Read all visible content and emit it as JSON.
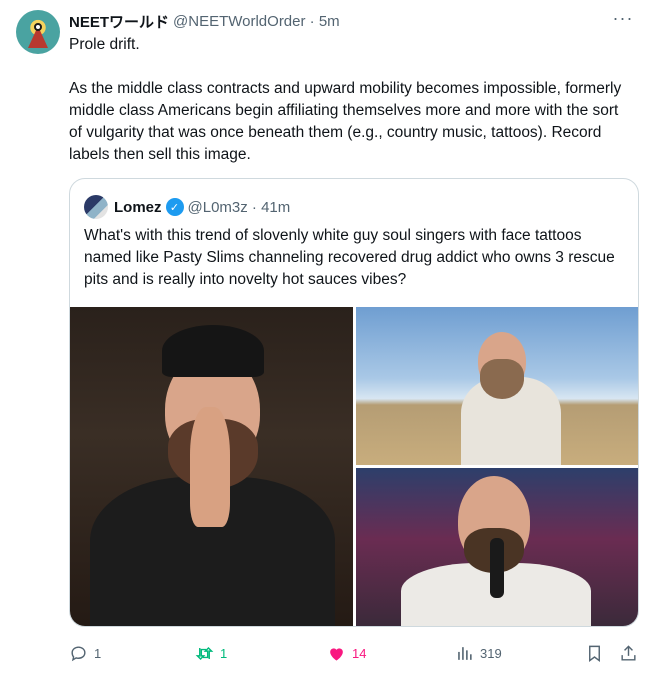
{
  "tweet": {
    "display_name": "NEETワールド",
    "handle": "@NEETWorldOrder · 5m",
    "text": "Prole drift.\n\nAs the middle class contracts and upward mobility becomes impossible, formerly middle class Americans begin affiliating themselves more and more with the sort of vulgarity that was once beneath them (e.g., country music, tattoos). Record labels then sell this image."
  },
  "quote": {
    "display_name": "Lomez",
    "handle": "@L0m3z · 41m",
    "text": "What's with this trend of slovenly white guy soul singers with face tattoos named like Pasty Slims channeling recovered drug addict who owns 3 rescue pits and is really into novelty hot sauces vibes?"
  },
  "actions": {
    "replies": "1",
    "retweets": "1",
    "likes": "14",
    "views": "319"
  },
  "icons": {
    "more": "more-icon",
    "verified": "verified-icon",
    "reply": "reply-icon",
    "retweet": "retweet-icon",
    "like": "heart-icon",
    "views": "views-icon",
    "bookmark": "bookmark-icon",
    "share": "share-icon"
  },
  "colors": {
    "text": "#0f1419",
    "muted": "#536471",
    "verified": "#1d9bf0",
    "retweet": "#00ba7c",
    "like": "#f91880",
    "border": "#cfd9de"
  }
}
